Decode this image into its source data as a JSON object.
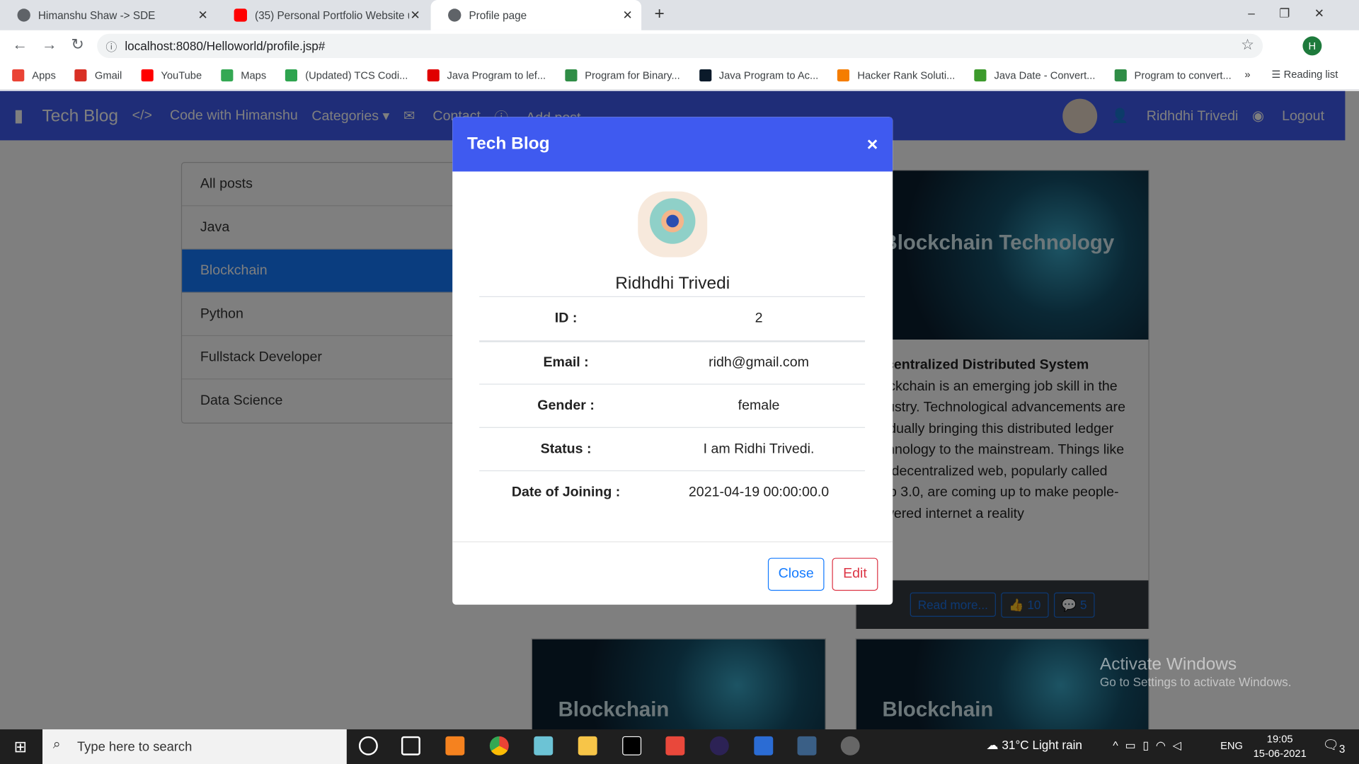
{
  "browser": {
    "tabs": [
      {
        "label": "Himanshu Shaw -> SDE",
        "icon": "globe-icon"
      },
      {
        "label": "(35) Personal Portfolio Website u",
        "icon": "youtube-icon"
      },
      {
        "label": "Profile page",
        "icon": "globe-icon",
        "active": true
      }
    ],
    "new_tab": "+",
    "url": "localhost:8080/Helloworld/profile.jsp#",
    "profile_initial": "H",
    "bookmarks": [
      {
        "label": "Apps",
        "color": "#ea4335"
      },
      {
        "label": "Gmail",
        "color": "#d93025"
      },
      {
        "label": "YouTube",
        "color": "#ff0000"
      },
      {
        "label": "Maps",
        "color": "#34a853"
      },
      {
        "label": "(Updated) TCS Codi...",
        "color": "#2ea44f"
      },
      {
        "label": "Java Program to lef...",
        "color": "#e00000"
      },
      {
        "label": "Program for Binary...",
        "color": "#2f8d46"
      },
      {
        "label": "Java Program to Ac...",
        "color": "#0b1a2a"
      },
      {
        "label": "Hacker Rank Soluti...",
        "color": "#f57d00"
      },
      {
        "label": "Java Date - Convert...",
        "color": "#3c9a2c"
      },
      {
        "label": "Program to convert...",
        "color": "#2f8d46"
      }
    ],
    "more": "»",
    "reading_list": "Reading list"
  },
  "navbar": {
    "brand": "Tech Blog",
    "links": [
      "Code with Himanshu",
      "Categories ▾",
      "Contact",
      "Add post"
    ],
    "user": "Ridhdhi Trivedi",
    "logout": "Logout",
    "color": "#3f5af0"
  },
  "sidebar": {
    "items": [
      "All posts",
      "Java",
      "Blockchain",
      "Python",
      "Fullstack Developer",
      "Data Science"
    ],
    "active": "Blockchain"
  },
  "post": {
    "image_text": "Blockchain Technology",
    "title": "Decentralized Distributed System",
    "body": "Blockchain is an emerging job skill in the industry. Technological advancements are gradually bringing this distributed ledger technology to the mainstream. Things like the decentralized web, popularly called Web 3.0, are coming up to make people-powered internet a reality",
    "read_more": "Read more...",
    "likes": "10",
    "comments": "5"
  },
  "post_image_text": "Blockchain",
  "modal": {
    "title": "Tech Blog",
    "close_x": "×",
    "name": "Ridhdhi Trivedi",
    "rows": [
      {
        "k": "ID :",
        "v": "2"
      },
      {
        "k": "Email :",
        "v": "ridh@gmail.com"
      },
      {
        "k": "Gender :",
        "v": "female"
      },
      {
        "k": "Status :",
        "v": "I am Ridhi Trivedi."
      },
      {
        "k": "Date of Joining :",
        "v": "2021-04-19 00:00:00.0"
      }
    ],
    "close": "Close",
    "edit": "Edit"
  },
  "watermark": {
    "title": "Activate Windows",
    "sub": "Go to Settings to activate Windows."
  },
  "taskbar": {
    "search": "Type here to search",
    "weather": "31°C  Light rain",
    "lang": "ENG",
    "time": "19:05",
    "date": "15-06-2021",
    "notif": "3"
  }
}
